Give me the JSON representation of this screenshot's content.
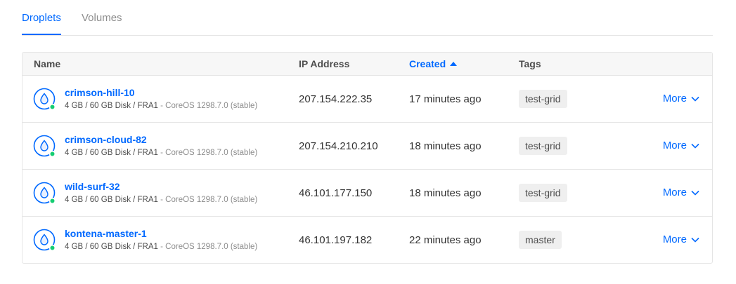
{
  "tabs": [
    {
      "label": "Droplets",
      "active": true
    },
    {
      "label": "Volumes",
      "active": false
    }
  ],
  "table": {
    "headers": {
      "name": "Name",
      "ip": "IP Address",
      "created": "Created",
      "tags": "Tags"
    },
    "sort": {
      "column": "created",
      "direction": "ascending"
    },
    "rows": [
      {
        "name": "crimson-hill-10",
        "specs": "4 GB / 60 GB Disk / FRA1",
        "os": " - CoreOS 1298.7.0 (stable)",
        "ip": "207.154.222.35",
        "created": "17 minutes ago",
        "tag": "test-grid",
        "more": "More",
        "status": "running"
      },
      {
        "name": "crimson-cloud-82",
        "specs": "4 GB / 60 GB Disk / FRA1",
        "os": " - CoreOS 1298.7.0 (stable)",
        "ip": "207.154.210.210",
        "created": "18 minutes ago",
        "tag": "test-grid",
        "more": "More",
        "status": "running"
      },
      {
        "name": "wild-surf-32",
        "specs": "4 GB / 60 GB Disk / FRA1",
        "os": " - CoreOS 1298.7.0 (stable)",
        "ip": "46.101.177.150",
        "created": "18 minutes ago",
        "tag": "test-grid",
        "more": "More",
        "status": "running"
      },
      {
        "name": "kontena-master-1",
        "specs": "4 GB / 60 GB Disk / FRA1",
        "os": " - CoreOS 1298.7.0 (stable)",
        "ip": "46.101.197.182",
        "created": "22 minutes ago",
        "tag": "master",
        "more": "More",
        "status": "running"
      }
    ]
  },
  "colors": {
    "accent": "#0069ff",
    "status_running": "#15cd72",
    "tag_bg": "#efefef"
  },
  "icons": {
    "droplet": "droplet-icon",
    "status": "status-dot-icon",
    "more": "chevron-down-icon",
    "sort": "sort-ascending-icon"
  }
}
